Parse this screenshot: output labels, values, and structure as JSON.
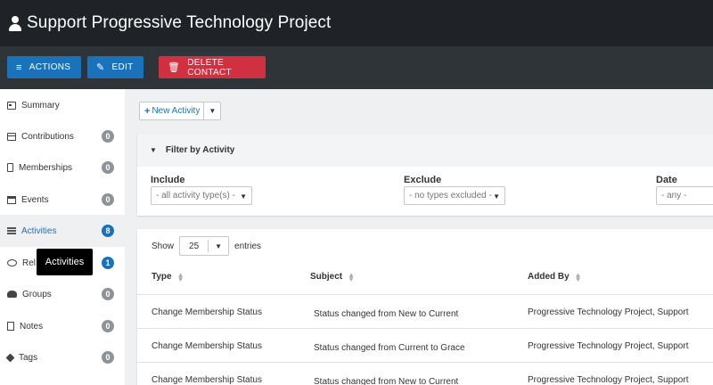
{
  "header": {
    "title": "Support Progressive Technology Project",
    "icon": "person-icon"
  },
  "actions": {
    "actions_label": "ACTIONS",
    "edit_label": "EDIT",
    "delete_label": "DELETE CONTACT"
  },
  "sidebar": {
    "items": [
      {
        "label": "Summary",
        "icon": "summary-icon",
        "count": null
      },
      {
        "label": "Contributions",
        "icon": "credit-card-icon",
        "count": "0"
      },
      {
        "label": "Memberships",
        "icon": "id-card-icon",
        "count": "0"
      },
      {
        "label": "Events",
        "icon": "calendar-icon",
        "count": "0"
      },
      {
        "label": "Activities",
        "icon": "list-icon",
        "count": "8"
      },
      {
        "label": "Rel",
        "icon": "handshake-icon",
        "count": "1"
      },
      {
        "label": "Groups",
        "icon": "users-icon",
        "count": "0"
      },
      {
        "label": "Notes",
        "icon": "note-icon",
        "count": "0"
      },
      {
        "label": "Tags",
        "icon": "tag-icon",
        "count": "0"
      }
    ]
  },
  "tooltip": {
    "text": "Activities"
  },
  "toolbar": {
    "new_activity_label": "New Activity"
  },
  "filter": {
    "title": "Filter by Activity",
    "include_label": "Include",
    "include_value": "- all activity type(s) -",
    "exclude_label": "Exclude",
    "exclude_value": "- no types excluded -",
    "date_label": "Date",
    "date_value": "- any -"
  },
  "table": {
    "show_label": "Show",
    "show_value": "25",
    "entries_label": "entries",
    "columns": [
      "Type",
      "Subject",
      "Added By"
    ],
    "rows": [
      {
        "type": "Change Membership Status",
        "subject": "Status changed from New to Current",
        "added_by": "Progressive Technology Project, Support"
      },
      {
        "type": "Change Membership Status",
        "subject": "Status changed from Current to Grace",
        "added_by": "Progressive Technology Project, Support"
      },
      {
        "type": "Change Membership Status",
        "subject": "Status changed from New to Current",
        "added_by": "Progressive Technology Project, Support"
      }
    ]
  },
  "colors": {
    "accent": "#1a73ba",
    "danger": "#d0303f",
    "header_bg": "#1f2327",
    "actionbar_bg": "#2f3439"
  }
}
